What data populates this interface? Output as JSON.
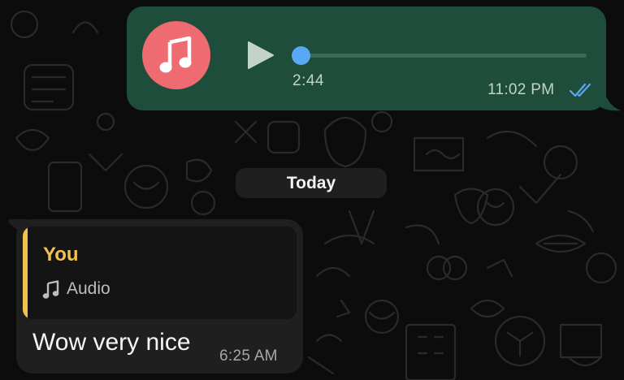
{
  "theme": {
    "wallpaper": "#0c0c0c",
    "outgoing_bubble": "#1e4d3b",
    "incoming_bubble": "#1f1f1f",
    "accent_blue": "#5aa8f5",
    "quote_accent": "#f1c24c",
    "avatar_color": "#ee6b71"
  },
  "voice_message": {
    "avatar_icon": "music-note-icon",
    "play_icon": "play-icon",
    "duration": "2:44",
    "progress": 0,
    "time": "11:02 PM",
    "status_icon": "double-check-read-icon"
  },
  "date_divider": {
    "label": "Today"
  },
  "reply_message": {
    "quote": {
      "author": "You",
      "icon": "music-note-icon",
      "label": "Audio"
    },
    "text": "Wow very nice",
    "time": "6:25 AM"
  }
}
